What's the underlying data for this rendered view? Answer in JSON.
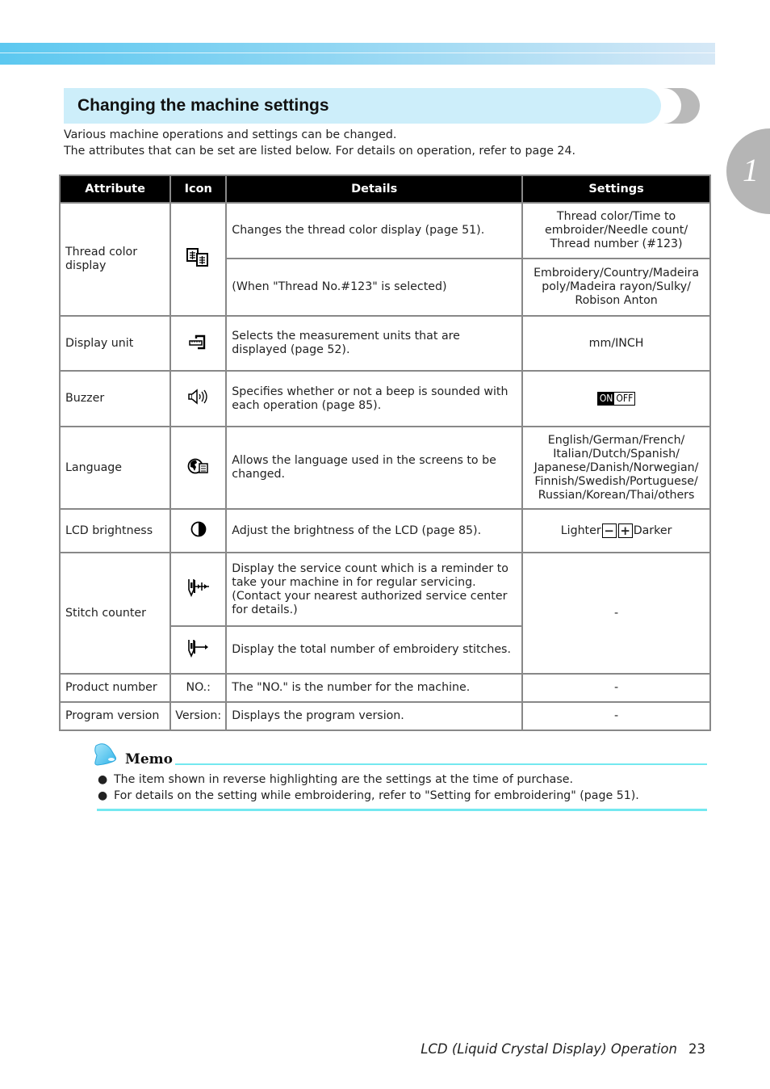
{
  "section": {
    "title": "Changing the machine settings"
  },
  "chapter_tab": {
    "number": "1"
  },
  "intro": {
    "line1": "Various machine operations and settings can be changed.",
    "line2": "The attributes that can be set are listed below. For details on operation, refer to page 24."
  },
  "table": {
    "headers": {
      "attribute": "Attribute",
      "icon": "Icon",
      "details": "Details",
      "settings": "Settings"
    },
    "rows": {
      "thread_color": {
        "attribute": "Thread color display",
        "icon": "thread-spools-icon",
        "details_1": "Changes the thread color display (page 51).",
        "settings_1": "Thread color/Time to embroider/Needle count/ Thread number (#123)",
        "details_2": "(When \"Thread No.#123\" is selected)",
        "settings_2": "Embroidery/Country/Madeira poly/Madeira rayon/Sulky/ Robison Anton"
      },
      "display_unit": {
        "attribute": "Display unit",
        "icon": "measuring-tape-icon",
        "details": "Selects the measurement units that are displayed (page 52).",
        "settings": "mm/INCH"
      },
      "buzzer": {
        "attribute": "Buzzer",
        "icon": "speaker-icon",
        "details": "Specifies whether or not a beep is sounded with each operation (page 85).",
        "settings_on": "ON",
        "settings_off": "OFF"
      },
      "language": {
        "attribute": "Language",
        "icon": "globe-language-icon",
        "details": "Allows the language used in the screens to be changed.",
        "settings": "English/German/French/ Italian/Dutch/Spanish/ Japanese/Danish/Norwegian/ Finnish/Swedish/Portuguese/ Russian/Korean/Thai/others"
      },
      "lcd_brightness": {
        "attribute": "LCD brightness",
        "icon": "half-circle-brightness-icon",
        "details": "Adjust the brightness of the LCD (page 85).",
        "settings_lighter": "Lighter",
        "settings_minus": "−",
        "settings_plus": "+",
        "settings_darker": "Darker"
      },
      "stitch_counter": {
        "attribute": "Stitch counter",
        "icon_1": "needle-service-count-icon",
        "details_1": "Display the service count which is a reminder to take your machine in for regular servicing. (Contact your nearest authorized service center for details.)",
        "icon_2": "needle-total-count-icon",
        "details_2": "Display the total number of embroidery stitches.",
        "settings": "-"
      },
      "product_number": {
        "attribute": "Product number",
        "icon": "NO.:",
        "details": "The \"NO.\" is the number for the machine.",
        "settings": "-"
      },
      "program_version": {
        "attribute": "Program version",
        "icon": "Version:",
        "details": "Displays the program version.",
        "settings": "-"
      }
    }
  },
  "memo": {
    "title": "Memo",
    "items": [
      "The item shown in reverse highlighting are the settings at the time of purchase.",
      "For details on the setting while embroidering, refer to \"Setting for embroidering\" (page 51)."
    ],
    "bullet": "●"
  },
  "footer": {
    "title": "LCD (Liquid Crystal Display) Operation",
    "page": "23"
  }
}
